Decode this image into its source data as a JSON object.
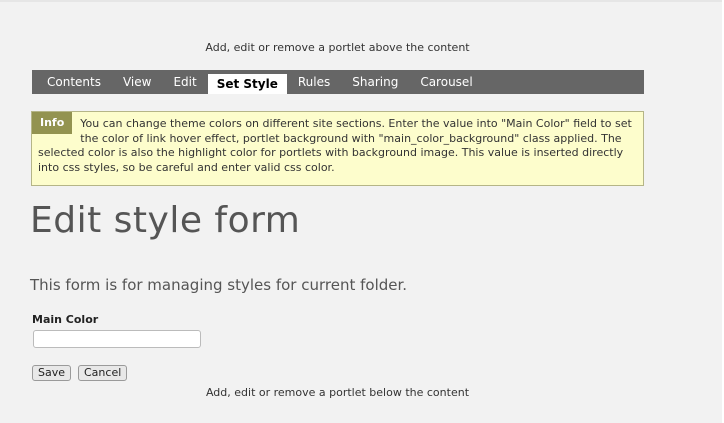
{
  "portlets": {
    "above": "Add, edit or remove a portlet above the content",
    "below": "Add, edit or remove a portlet below the content"
  },
  "tabs": [
    {
      "label": "Contents",
      "active": false
    },
    {
      "label": "View",
      "active": false
    },
    {
      "label": "Edit",
      "active": false
    },
    {
      "label": "Set Style",
      "active": true
    },
    {
      "label": "Rules",
      "active": false
    },
    {
      "label": "Sharing",
      "active": false
    },
    {
      "label": "Carousel",
      "active": false
    }
  ],
  "info": {
    "label": "Info",
    "text": "You can change theme colors on different site sections. Enter the value into \"Main Color\" field to set the color of link hover effect, portlet background with \"main_color_background\" class applied. The selected color is also the highlight color for portlets with background image. This value is inserted directly into css styles, so be careful and enter valid css color."
  },
  "form": {
    "title": "Edit style form",
    "description": "This form is for managing styles for current folder.",
    "main_color_label": "Main Color",
    "main_color_value": "",
    "save_label": "Save",
    "cancel_label": "Cancel"
  },
  "colors": {
    "tab_bar": "#666666",
    "info_background": "#fdfdcc",
    "info_label": "#939350",
    "page_background": "#f2f2f2"
  }
}
